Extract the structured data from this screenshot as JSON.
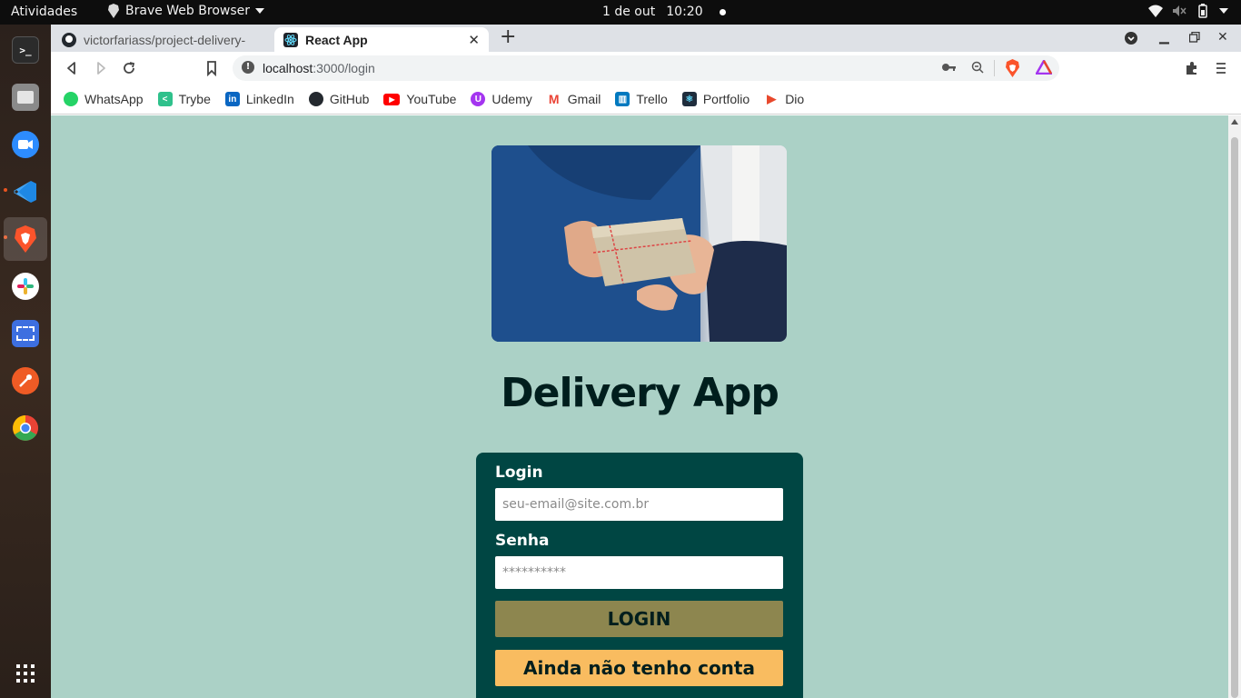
{
  "topbar": {
    "activities": "Atividades",
    "app_name": "Brave Web Browser",
    "date": "1 de out",
    "time": "10:20"
  },
  "dock": {
    "items": [
      {
        "name": "terminal-icon",
        "color": "#2b2b2b"
      },
      {
        "name": "files-icon",
        "color": "#8a8a8a"
      },
      {
        "name": "zoom-icon",
        "color": "#2d8cff"
      },
      {
        "name": "vscode-icon",
        "color": "#1e88e5"
      },
      {
        "name": "brave-icon",
        "color": "#fb542b"
      },
      {
        "name": "slack-icon",
        "color": "#ffffff"
      },
      {
        "name": "screenshot-icon",
        "color": "#3d6fe0"
      },
      {
        "name": "postman-icon",
        "color": "#ef5b25"
      },
      {
        "name": "chrome-icon",
        "color": "#ea4335"
      }
    ],
    "show_apps_label": "show-apps-icon"
  },
  "browser": {
    "tabs": [
      {
        "title": "victorfariass/project-delivery-",
        "active": false
      },
      {
        "title": "React App",
        "active": true
      }
    ],
    "url_host": "localhost",
    "url_path": ":3000/login",
    "bookmarks": [
      {
        "label": "WhatsApp",
        "color": "#25d366",
        "glyph": "W"
      },
      {
        "label": "Trybe",
        "color": "#2fc18c",
        "glyph": "T"
      },
      {
        "label": "LinkedIn",
        "color": "#0a66c2",
        "glyph": "in"
      },
      {
        "label": "GitHub",
        "color": "#24292f",
        "glyph": "G"
      },
      {
        "label": "YouTube",
        "color": "#ff0000",
        "glyph": "▶"
      },
      {
        "label": "Udemy",
        "color": "#a435f0",
        "glyph": "U"
      },
      {
        "label": "Gmail",
        "color": "#ea4335",
        "glyph": "M"
      },
      {
        "label": "Trello",
        "color": "#0079bf",
        "glyph": "▥"
      },
      {
        "label": "Portfolio",
        "color": "#1f2d3d",
        "glyph": "⚛"
      },
      {
        "label": "Dio",
        "color": "#e8482c",
        "glyph": "▷"
      }
    ]
  },
  "page": {
    "title": "Delivery App",
    "login_label": "Login",
    "email_placeholder": "seu-email@site.com.br",
    "password_label": "Senha",
    "password_placeholder": "**********",
    "login_button": "LOGIN",
    "register_button": "Ainda não tenho conta"
  },
  "colors": {
    "background": "#abd1c6",
    "card": "#004643",
    "login_button": "#8d864f",
    "register_button": "#f9bc60",
    "title": "#001e1d"
  }
}
